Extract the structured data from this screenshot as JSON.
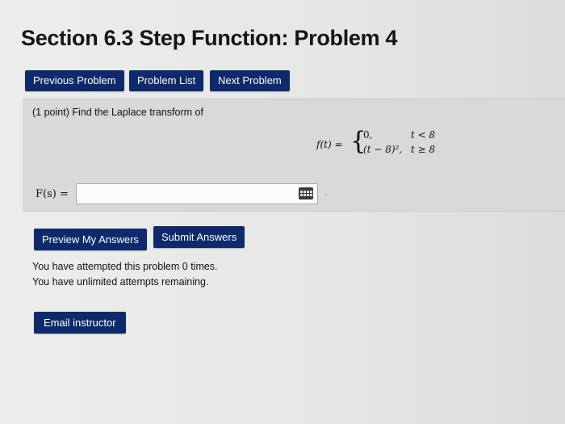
{
  "page": {
    "title": "Section 6.3 Step Function: Problem 4"
  },
  "nav": {
    "previous_label": "Previous Problem",
    "list_label": "Problem List",
    "next_label": "Next Problem"
  },
  "problem": {
    "prompt": "(1 point) Find the Laplace transform of",
    "function": {
      "lhs": "f(t) =",
      "case1_value": "0,",
      "case1_condition": "t < 8",
      "case2_value": "(t − 8)²,",
      "case2_condition": "t ≥ 8"
    }
  },
  "answer": {
    "label": "F(s) =",
    "value": "",
    "icon": "keypad-icon"
  },
  "actions": {
    "preview_label": "Preview My Answers",
    "submit_label": "Submit Answers"
  },
  "status": {
    "attempts_line": "You have attempted this problem 0 times.",
    "remaining_line": "You have unlimited attempts remaining."
  },
  "footer": {
    "email_label": "Email instructor"
  },
  "colors": {
    "button_bg": "#0e2a6b",
    "button_text": "#ffffff",
    "panel_bg": "#d9d9d7"
  }
}
